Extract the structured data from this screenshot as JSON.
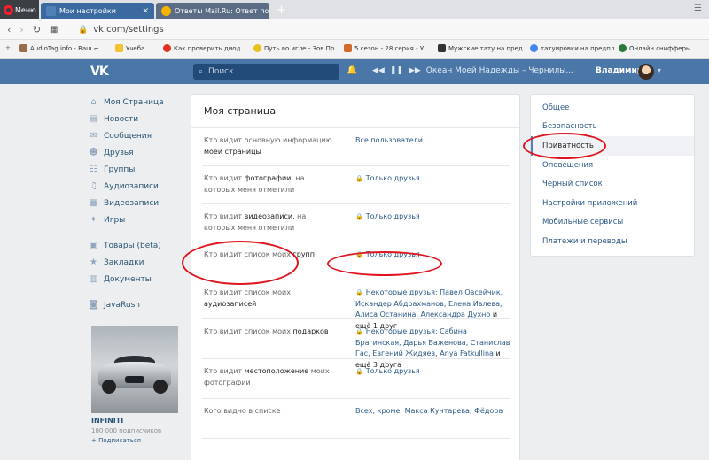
{
  "browser": {
    "menu_label": "Меню",
    "tabs": [
      {
        "label": "Мои настройки"
      },
      {
        "label": "Ответы Mail.Ru: Ответ по..."
      }
    ],
    "new_tab": "+",
    "address": "vk.com/settings"
  },
  "bookmarks": [
    "AudioTag.info - Ваш ⌐",
    "Учеба",
    "Как проверить диод",
    "Путь во игле - Зов Пр",
    "5 сезон - 28 серия - У",
    "Мужские тату на пред",
    "татуировки на предпл",
    "Онлайн снифферы"
  ],
  "header": {
    "logo": "VK",
    "search_placeholder": "Поиск",
    "now_playing": "Океан Моей Надежды – Чернилы...",
    "user_name": "Владимир"
  },
  "left_menu": {
    "items": [
      {
        "label": "Моя Страница",
        "icon": "home-icon",
        "glyph": "⌂"
      },
      {
        "label": "Новости",
        "icon": "news-icon",
        "glyph": "▤"
      },
      {
        "label": "Сообщения",
        "icon": "messages-icon",
        "glyph": "✉"
      },
      {
        "label": "Друзья",
        "icon": "friends-icon",
        "glyph": "☻"
      },
      {
        "label": "Группы",
        "icon": "groups-icon",
        "glyph": "☷"
      },
      {
        "label": "Аудиозаписи",
        "icon": "audio-icon",
        "glyph": "♫"
      },
      {
        "label": "Видеозаписи",
        "icon": "video-icon",
        "glyph": "▦"
      },
      {
        "label": "Игры",
        "icon": "games-icon",
        "glyph": "✦"
      }
    ],
    "items2": [
      {
        "label": "Товары (beta)",
        "icon": "goods-icon",
        "glyph": "▣"
      },
      {
        "label": "Закладки",
        "icon": "bookmarks-icon",
        "glyph": "★"
      },
      {
        "label": "Документы",
        "icon": "documents-icon",
        "glyph": "▥"
      }
    ],
    "items3": [
      {
        "label": "JavaRush",
        "icon": "app-icon",
        "glyph": "◙"
      }
    ],
    "ad": {
      "title": "INFINITI",
      "subscribers": "180 000 подписчиков",
      "subscribe": "+ Подписаться"
    }
  },
  "card": {
    "title": "Моя страница",
    "rows": [
      {
        "label_pre": "Кто видит основную информацию ",
        "label_b": "моей страницы",
        "lock": false,
        "value": "Все пользователи"
      },
      {
        "label_pre": "Кто видит ",
        "label_b": "фотографии,",
        "label_post": " на которых меня отметили",
        "lock": true,
        "value": "Только друзья"
      },
      {
        "label_pre": "Кто видит ",
        "label_b": "видеозаписи,",
        "label_post": " на которых меня отметили",
        "lock": true,
        "value": "Только друзья"
      },
      {
        "label_pre": "Кто видит список моих ",
        "label_b": "групп",
        "lock": true,
        "value": "Только друзья"
      },
      {
        "label_pre": "Кто видит список моих ",
        "label_b": "аудиозаписей",
        "lock": true,
        "value": "Некоторые друзья: Павел Овсейчик, Искандер Абдрахманов, Елена Ивлева, Алиса Останина, Александра Духно",
        "value_tail": " и ещё 1 друг"
      },
      {
        "label_pre": "Кто видит список моих ",
        "label_b": "подарков",
        "lock": true,
        "value": "Некоторые друзья: Сабина Брагинская, Дарья Баженова, Станислав Гас, Евгений Жидяев, Anya Fatkullina",
        "value_tail": " и ещё 3 друга"
      },
      {
        "label_pre": "Кто видит ",
        "label_b": "местоположение",
        "label_post": " моих фотографий",
        "lock": true,
        "value": "Только друзья"
      },
      {
        "label_pre": "Кого видно в списке",
        "label_b": "",
        "lock": false,
        "value": "Всех, кроме: Макса Кунтарева, Фёдора"
      }
    ]
  },
  "right_menu": {
    "items": [
      "Общее",
      "Безопасность",
      "Приватность",
      "Оповещения",
      "Чёрный список",
      "Настройки приложений",
      "Мобильные сервисы",
      "Платежи и переводы"
    ],
    "active": "Приватность"
  }
}
